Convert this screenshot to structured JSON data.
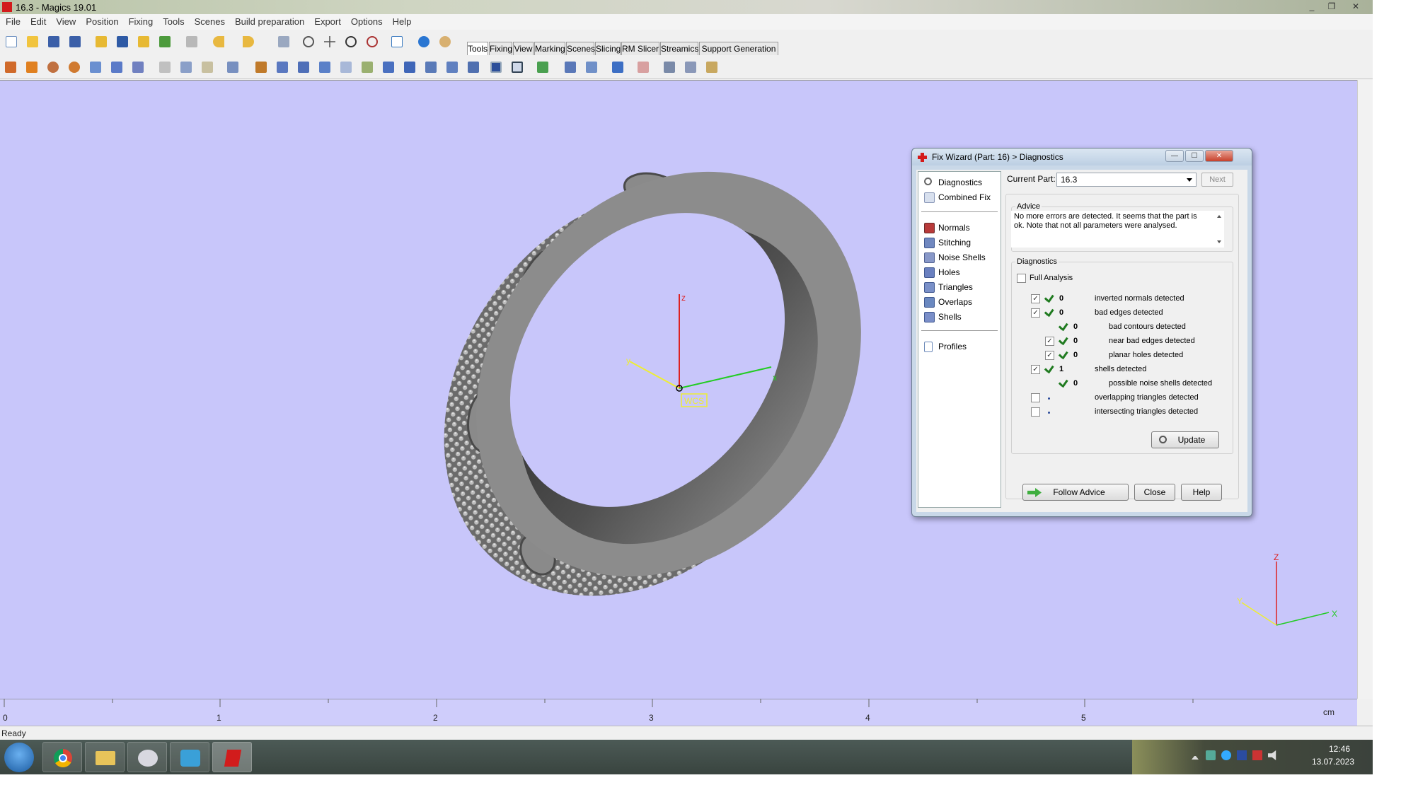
{
  "window": {
    "title": "16.3 - Magics 19.01",
    "minimize": "_",
    "restore": "❐",
    "close": "✕"
  },
  "menu": [
    "File",
    "Edit",
    "View",
    "Position",
    "Fixing",
    "Tools",
    "Scenes",
    "Build preparation",
    "Export",
    "Options",
    "Help"
  ],
  "tabs": [
    {
      "label": "Tools",
      "active": true
    },
    {
      "label": "Fixing",
      "active": false
    },
    {
      "label": "View",
      "active": false
    },
    {
      "label": "Marking",
      "active": false
    },
    {
      "label": "Scenes",
      "active": false
    },
    {
      "label": "Slicing",
      "active": false
    },
    {
      "label": "RM Slicer",
      "active": false
    },
    {
      "label": "Streamics",
      "active": false
    },
    {
      "label": "Support Generation",
      "active": false
    }
  ],
  "viewport": {
    "background": "#c8c6fa",
    "wcs_label": "WCS",
    "axis_labels": {
      "x": "x",
      "z": "z",
      "y": "y"
    },
    "corner_axis_labels": {
      "x": "X",
      "z": "Z",
      "y": "Y"
    }
  },
  "ruler": {
    "labels": [
      "0",
      "1",
      "2",
      "3",
      "4",
      "5"
    ],
    "unit": "cm"
  },
  "status": {
    "text": "Ready"
  },
  "taskbar": {
    "time": "12:46",
    "date": "13.07.2023"
  },
  "dialog": {
    "title": "Fix Wizard (Part: 16) > Diagnostics",
    "min_btn": "—",
    "max_btn": "☐",
    "close_btn": "✕",
    "nav_top": [
      {
        "label": "Diagnostics",
        "icon": "magnifier-icon"
      },
      {
        "label": "Combined Fix",
        "icon": "cube-icon"
      }
    ],
    "nav_tools": [
      {
        "label": "Normals",
        "icon": "normals-cube-icon"
      },
      {
        "label": "Stitching",
        "icon": "stitching-icon"
      },
      {
        "label": "Noise Shells",
        "icon": "noise-shells-icon"
      },
      {
        "label": "Holes",
        "icon": "holes-icon"
      },
      {
        "label": "Triangles",
        "icon": "triangles-icon"
      },
      {
        "label": "Overlaps",
        "icon": "overlaps-icon"
      },
      {
        "label": "Shells",
        "icon": "shells-icon"
      }
    ],
    "nav_bottom": [
      {
        "label": "Profiles",
        "icon": "document-icon"
      }
    ],
    "current_part_label": "Current Part:",
    "current_part_value": "16.3",
    "next_button": "Next",
    "advice_title": "Advice",
    "advice_text": "No more errors are detected. It seems that the part is ok. Note that not all parameters were analysed.",
    "diagnostics_title": "Diagnostics",
    "full_analysis_label": "Full Analysis",
    "full_analysis_checked": false,
    "rows": [
      {
        "checked": true,
        "status": "ok",
        "count": "0",
        "label": "inverted normals detected",
        "indent": 0,
        "has_checkbox": true
      },
      {
        "checked": true,
        "status": "ok",
        "count": "0",
        "label": "bad edges detected",
        "indent": 0,
        "has_checkbox": true
      },
      {
        "checked": true,
        "status": "ok",
        "count": "0",
        "label": "bad contours detected",
        "indent": 1,
        "has_checkbox": false
      },
      {
        "checked": true,
        "status": "ok",
        "count": "0",
        "label": "near bad edges detected",
        "indent": 1,
        "has_checkbox": true
      },
      {
        "checked": true,
        "status": "ok",
        "count": "0",
        "label": "planar holes detected",
        "indent": 1,
        "has_checkbox": true
      },
      {
        "checked": true,
        "status": "ok",
        "count": "1",
        "label": "shells detected",
        "indent": 0,
        "has_checkbox": true
      },
      {
        "checked": true,
        "status": "ok",
        "count": "0",
        "label": "possible noise shells detected",
        "indent": 1,
        "has_checkbox": false
      },
      {
        "checked": false,
        "status": "pending",
        "count": "",
        "label": "overlapping triangles detected",
        "indent": 0,
        "has_checkbox": true
      },
      {
        "checked": false,
        "status": "pending",
        "count": "",
        "label": "intersecting triangles detected",
        "indent": 0,
        "has_checkbox": true
      }
    ],
    "update_button": "Update",
    "follow_advice_button": "Follow Advice",
    "close_button": "Close",
    "help_button": "Help"
  }
}
